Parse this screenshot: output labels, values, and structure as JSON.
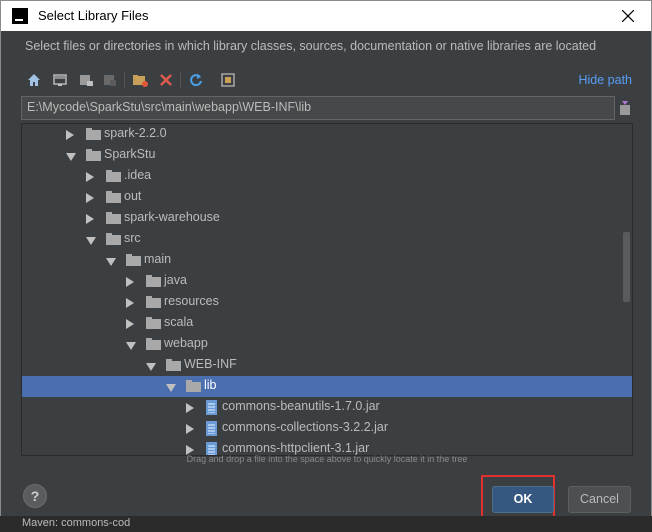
{
  "window": {
    "title": "Select Library Files",
    "icon": "intellij-icon",
    "close_icon": "close-icon"
  },
  "dialog": {
    "description": "Select files or directories in which library classes, sources, documentation or native libraries are located",
    "toolbar": [
      {
        "name": "home-icon"
      },
      {
        "name": "desktop-icon"
      },
      {
        "name": "project-icon"
      },
      {
        "name": "module-icon"
      },
      {
        "name": "new-folder-icon"
      },
      {
        "name": "delete-icon"
      },
      {
        "name": "refresh-icon"
      },
      {
        "name": "show-hidden-icon"
      }
    ],
    "hide_path_label": "Hide path",
    "path_value": "E:\\Mycode\\SparkStu\\src\\main\\webapp\\WEB-INF\\lib",
    "tree": [
      {
        "label": "spark-2.2.0",
        "type": "folder",
        "state": "collapsed",
        "depth": 0
      },
      {
        "label": "SparkStu",
        "type": "folder",
        "state": "expanded",
        "depth": 0
      },
      {
        "label": ".idea",
        "type": "folder",
        "state": "collapsed",
        "depth": 1
      },
      {
        "label": "out",
        "type": "folder",
        "state": "collapsed",
        "depth": 1
      },
      {
        "label": "spark-warehouse",
        "type": "folder",
        "state": "collapsed",
        "depth": 1
      },
      {
        "label": "src",
        "type": "folder",
        "state": "expanded",
        "depth": 1
      },
      {
        "label": "main",
        "type": "folder",
        "state": "expanded",
        "depth": 2
      },
      {
        "label": "java",
        "type": "folder",
        "state": "collapsed",
        "depth": 3
      },
      {
        "label": "resources",
        "type": "folder",
        "state": "collapsed",
        "depth": 3
      },
      {
        "label": "scala",
        "type": "folder",
        "state": "collapsed",
        "depth": 3
      },
      {
        "label": "webapp",
        "type": "folder",
        "state": "expanded",
        "depth": 3
      },
      {
        "label": "WEB-INF",
        "type": "folder",
        "state": "expanded",
        "depth": 4
      },
      {
        "label": "lib",
        "type": "folder",
        "state": "expanded",
        "depth": 5,
        "selected": true
      },
      {
        "label": "commons-beanutils-1.7.0.jar",
        "type": "jar",
        "state": "collapsed",
        "depth": 6
      },
      {
        "label": "commons-collections-3.2.2.jar",
        "type": "jar",
        "state": "collapsed",
        "depth": 6
      },
      {
        "label": "commons-httpclient-3.1.jar",
        "type": "jar",
        "state": "collapsed",
        "depth": 6
      }
    ],
    "drag_hint": "Drag and drop a file into the space above to quickly locate it in the tree",
    "help_label": "?",
    "ok_label": "OK",
    "cancel_label": "Cancel"
  },
  "background": {
    "behind_text": "Maven: commons-cod"
  },
  "colors": {
    "selection": "#4b6eaf",
    "link": "#589df6",
    "highlight_border": "#e03030",
    "primary_button": "#365880"
  }
}
